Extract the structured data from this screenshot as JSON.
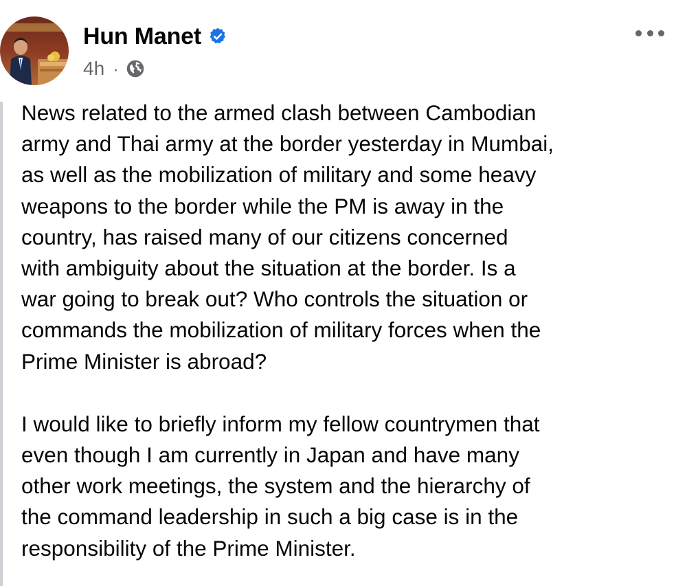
{
  "post": {
    "author": {
      "name": "Hun Manet",
      "verified": true,
      "avatar_icon": "profile-photo"
    },
    "meta": {
      "timestamp": "4h",
      "separator": "·",
      "audience_icon": "globe-icon"
    },
    "menu_icon": "more-options-icon",
    "paragraphs": [
      "News related to the armed clash between Cambodian\narmy and Thai army at the border yesterday in Mumbai,\nas well as the mobilization of military and some heavy\nweapons to the border while the PM is away in the\ncountry, has raised many of our citizens concerned\nwith ambiguity about the situation at the border. Is a\nwar going to break out? Who controls the situation or\ncommands the mobilization of military forces when the\nPrime Minister is abroad?",
      "I would like to briefly inform my fellow countrymen that\neven though I am currently in Japan and have many\nother work meetings, the system and the hierarchy of\nthe command leadership in such a big case is in the\nresponsibility of the Prime Minister."
    ]
  },
  "colors": {
    "text_primary": "#050505",
    "text_secondary": "#65676b",
    "verified_badge": "#1b74e4"
  }
}
